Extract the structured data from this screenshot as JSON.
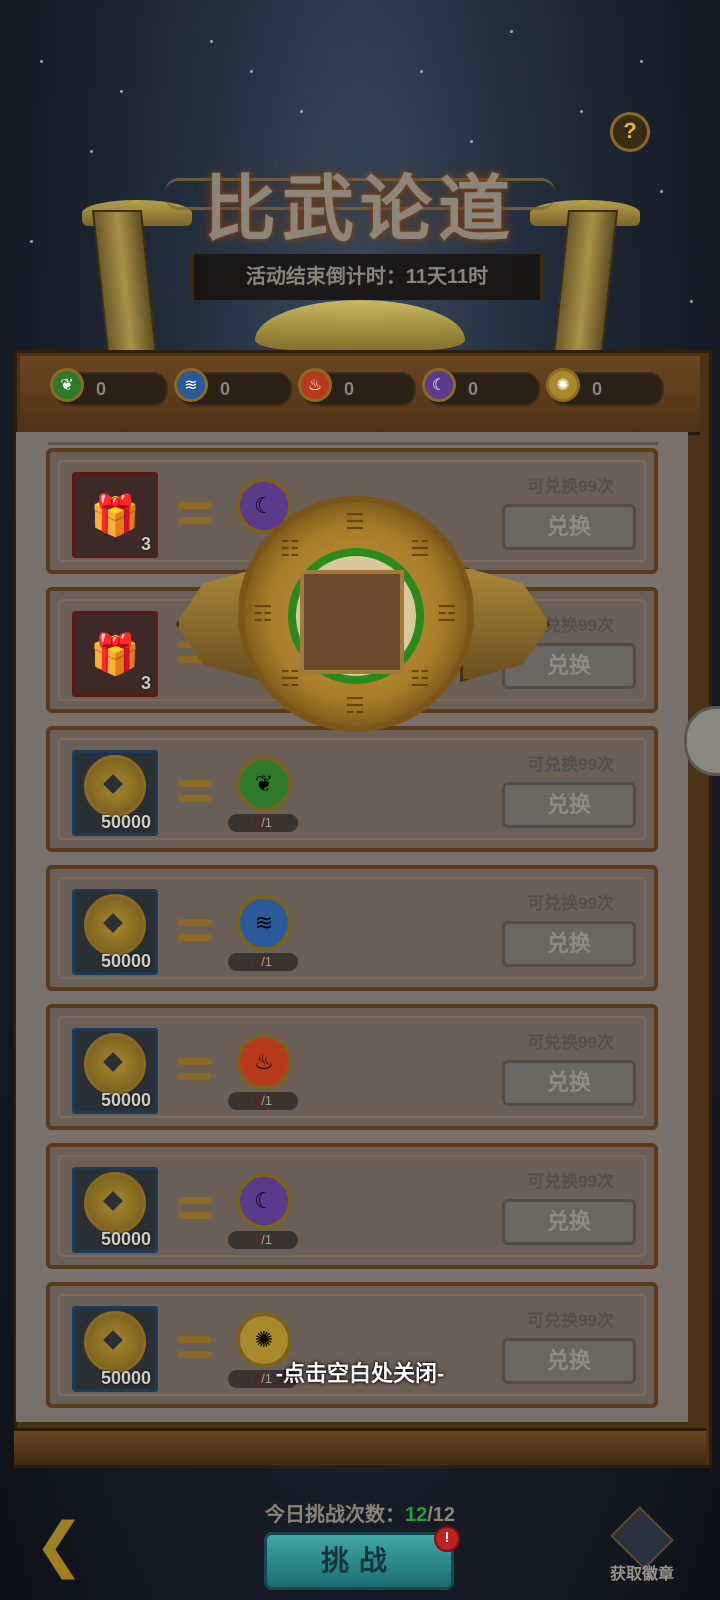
{
  "title": "比武论道",
  "countdown": "活动结束倒计时：11天11时",
  "help_icon": "question-mark-icon",
  "badges": [
    {
      "element": "wood",
      "icon": "leaf-icon",
      "symbol": "❦",
      "color": "#2f7a2a",
      "count": "0"
    },
    {
      "element": "water",
      "icon": "water-wave-icon",
      "symbol": "≋",
      "color": "#2a5a9a",
      "count": "0"
    },
    {
      "element": "fire",
      "icon": "flame-icon",
      "symbol": "♨",
      "color": "#b83a1a",
      "count": "0"
    },
    {
      "element": "moon",
      "icon": "moon-icon",
      "symbol": "☾",
      "color": "#5a3a8a",
      "count": "0"
    },
    {
      "element": "metal",
      "icon": "sun-disc-icon",
      "symbol": "✺",
      "color": "#a88a2a",
      "count": "0"
    }
  ],
  "rows": [
    {
      "item_icon": "gift-bundle-icon",
      "item_qty": "3",
      "target_icon": "moon-icon",
      "target_symbol": "☾",
      "target_color": "#5a3a8a",
      "progress_cur": "",
      "progress_max": "",
      "limit": "可兑换99次",
      "button": "兑换"
    },
    {
      "item_icon": "gift-bundle-icon",
      "item_qty": "3",
      "target_icon": "",
      "target_symbol": "",
      "target_color": "",
      "progress_cur": "",
      "progress_max": "",
      "limit": "可兑换99次",
      "button": "兑换"
    },
    {
      "item_icon": "coin-icon",
      "item_qty": "50000",
      "target_icon": "leaf-icon",
      "target_symbol": "❦",
      "target_color": "#2f7a2a",
      "progress_cur": "0",
      "progress_max": "/1",
      "limit": "可兑换99次",
      "button": "兑换"
    },
    {
      "item_icon": "coin-icon",
      "item_qty": "50000",
      "target_icon": "water-wave-icon",
      "target_symbol": "≋",
      "target_color": "#2a5a9a",
      "progress_cur": "0",
      "progress_max": "/1",
      "limit": "可兑换99次",
      "button": "兑换"
    },
    {
      "item_icon": "coin-icon",
      "item_qty": "50000",
      "target_icon": "flame-icon",
      "target_symbol": "♨",
      "target_color": "#b83a1a",
      "progress_cur": "0",
      "progress_max": "/1",
      "limit": "可兑换99次",
      "button": "兑换"
    },
    {
      "item_icon": "coin-icon",
      "item_qty": "50000",
      "target_icon": "moon-icon",
      "target_symbol": "☾",
      "target_color": "#5a3a8a",
      "progress_cur": "0",
      "progress_max": "/1",
      "limit": "可兑换99次",
      "button": "兑换"
    },
    {
      "item_icon": "coin-icon",
      "item_qty": "50000",
      "target_icon": "sun-disc-icon",
      "target_symbol": "✺",
      "target_color": "#a88a2a",
      "progress_cur": "0",
      "progress_max": "/1",
      "limit": "可兑换99次",
      "button": "兑换"
    }
  ],
  "overlay": {
    "medal_icon": "bagua-medal-icon",
    "trigrams": [
      "☰",
      "☱",
      "☲",
      "☳",
      "☴",
      "☵",
      "☶",
      "☷"
    ],
    "close_hint": "-点击空白处关闭-"
  },
  "footer": {
    "challenges_label": "今日挑战次数：",
    "challenges_used": "12",
    "challenges_total": "/12",
    "challenge_button": "挑战",
    "alert": "!",
    "get_badge_label": "获取徽章",
    "back_icon": "back-arrow-icon"
  },
  "colors": {
    "accent_green": "#2f9a3a",
    "button_teal": "#2e8a8a",
    "alert_red": "#c02020"
  }
}
